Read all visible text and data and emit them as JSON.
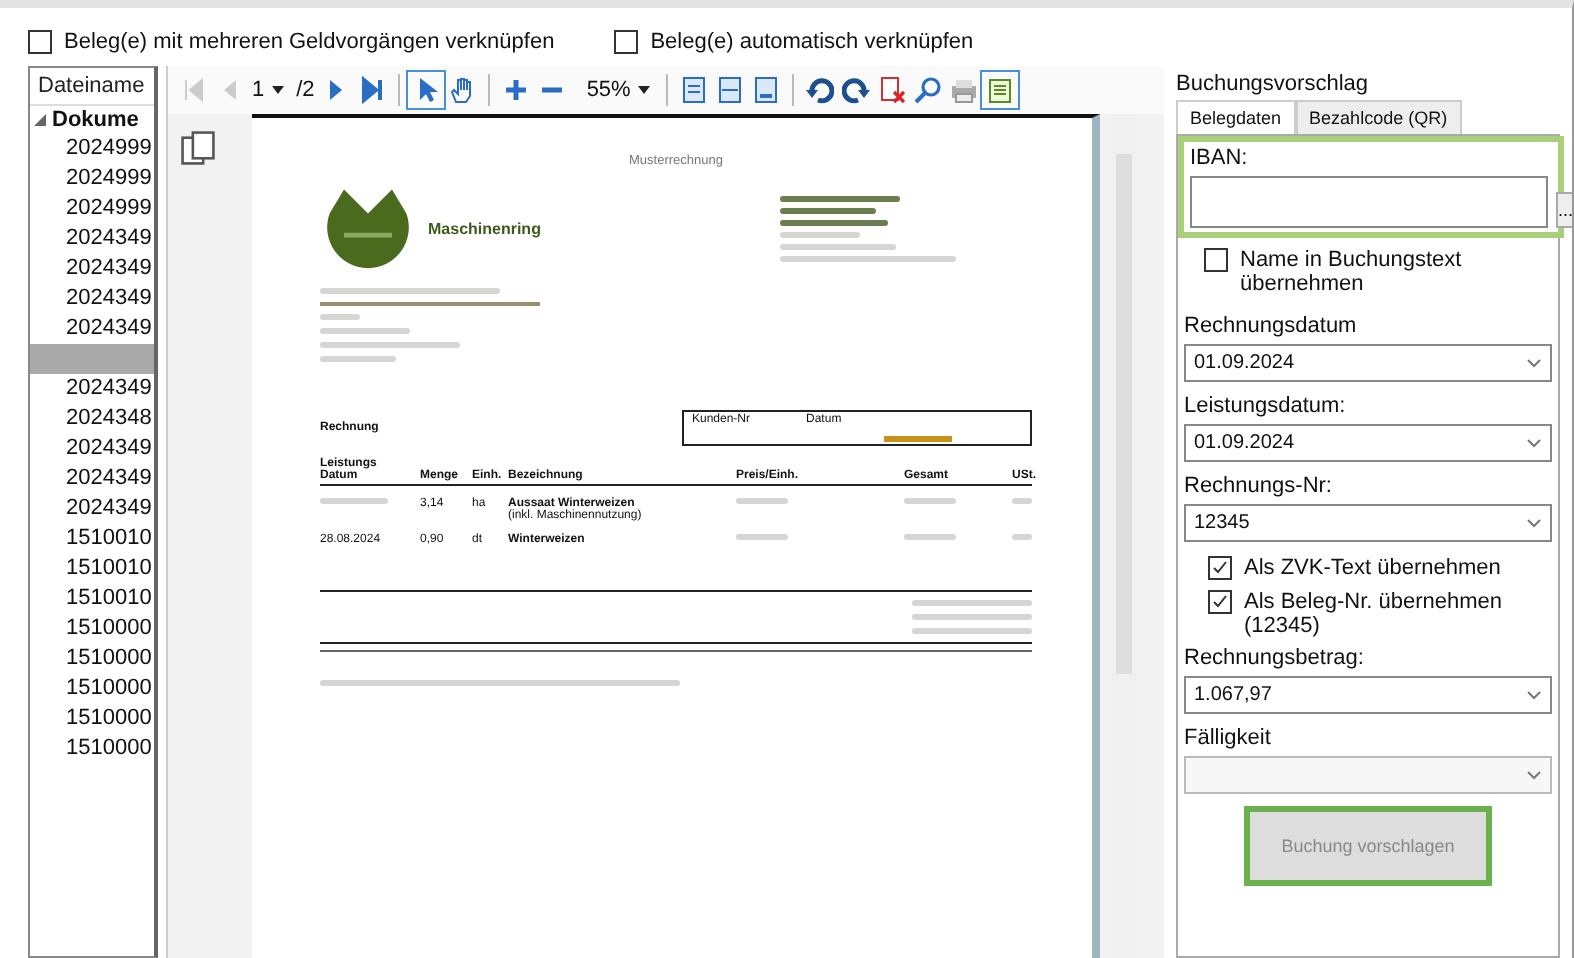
{
  "options": [
    {
      "label": "Beleg(e) mit mehreren Geldvorgängen verknüpfen",
      "checked": false
    },
    {
      "label": "Beleg(e) automatisch verknüpfen",
      "checked": false
    }
  ],
  "file_list": {
    "header": "Dateiname",
    "group": {
      "label": "Dokume",
      "expanded": true,
      "children": [
        {
          "name": "2024999",
          "selected": false
        },
        {
          "name": "2024999",
          "selected": false
        },
        {
          "name": "2024999",
          "selected": false
        },
        {
          "name": "2024349",
          "selected": false
        },
        {
          "name": "2024349",
          "selected": false
        },
        {
          "name": "2024349",
          "selected": false
        },
        {
          "name": "2024349",
          "selected": false
        },
        {
          "selected": true
        },
        {
          "name": "2024349",
          "selected": false
        },
        {
          "name": "2024348",
          "selected": false
        },
        {
          "name": "2024349",
          "selected": false
        },
        {
          "name": "2024349",
          "selected": false
        },
        {
          "name": "2024349",
          "selected": false
        },
        {
          "name": "1510010",
          "selected": false
        },
        {
          "name": "1510010",
          "selected": false
        },
        {
          "name": "1510010",
          "selected": false
        },
        {
          "name": "1510000",
          "selected": false
        },
        {
          "name": "1510000",
          "selected": false
        },
        {
          "name": "1510000",
          "selected": false
        },
        {
          "name": "1510000",
          "selected": false
        },
        {
          "name": "1510000",
          "selected": false
        }
      ]
    }
  },
  "viewer": {
    "page": "1",
    "page_count": "/2",
    "zoom": "55%",
    "document": {
      "title": "Musterrechnung",
      "company": "Maschinenring",
      "heading": "Rechnung",
      "info_labels": [
        "Kunden-Nr",
        "Datum"
      ],
      "columns": [
        "Leistungs Datum",
        "Menge",
        "Einh.",
        "Bezeichnung",
        "Preis/Einh.",
        "Gesamt",
        "USt."
      ],
      "rows": [
        {
          "date": "",
          "qty": "3,14",
          "unit": "ha",
          "desc": "Aussaat Winterweizen",
          "note": "(inkl. Maschinennutzung)"
        },
        {
          "date": "28.08.2024",
          "qty": "0,90",
          "unit": "dt",
          "desc": "Winterweizen"
        }
      ]
    }
  },
  "booking": {
    "title": "Buchungsvorschlag",
    "tabs": [
      {
        "label": "Belegdaten",
        "selected": true
      },
      {
        "label": "Bezahlcode (QR)",
        "selected": false
      }
    ],
    "iban": {
      "label": "IBAN:",
      "button": "..."
    },
    "name_option": {
      "label": "Name in Buchungstext übernehmen",
      "checked": false
    },
    "fields": [
      {
        "kind": "combo",
        "label": "Rechnungsdatum",
        "value": "01.09.2024",
        "disabled": false
      },
      {
        "kind": "combo",
        "label": "Leistungsdatum:",
        "value": "01.09.2024",
        "disabled": false
      },
      {
        "kind": "combo",
        "label": "Rechnungs-Nr:",
        "value": "12345",
        "disabled": false
      },
      {
        "kind": "check",
        "label": "Als ZVK-Text übernehmen",
        "checked": true
      },
      {
        "kind": "check",
        "label": "Als Beleg-Nr. übernehmen (12345)",
        "checked": true
      },
      {
        "kind": "combo",
        "label": "Rechnungsbetrag:",
        "value": "1.067,97",
        "disabled": false
      },
      {
        "kind": "combo",
        "label": "Fälligkeit",
        "disabled": true
      }
    ],
    "submit": {
      "label": "Buchung vorschlagen",
      "disabled": true
    }
  }
}
